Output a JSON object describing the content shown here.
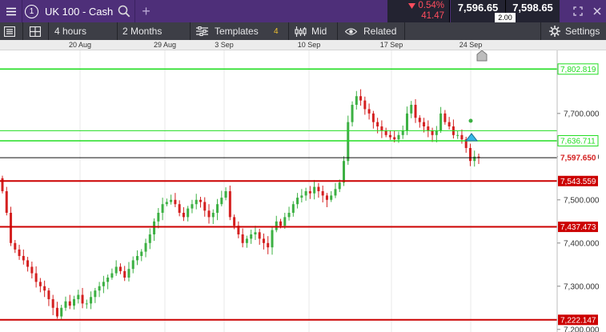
{
  "header": {
    "instrument_index": "1",
    "instrument_name": "UK 100 - Cash",
    "add_symbol": "+",
    "change_percent": "0.54%",
    "change_points": "41.47",
    "sell_price": "7,596.65",
    "buy_price": "7,598.65",
    "spread": "2.00",
    "colors": {
      "bar": "#4e2f79",
      "change": "#ff4d5e",
      "price_box": "#232331"
    }
  },
  "toolbar": {
    "interval": "4 hours",
    "range": "2 Months",
    "templates_label": "Templates",
    "templates_count": "4",
    "price_type": "Mid",
    "related_label": "Related",
    "settings_label": "Settings"
  },
  "chart_data": {
    "type": "candlestick",
    "x_ticks": [
      "20 Aug",
      "29 Aug",
      "3 Sep",
      "10 Sep",
      "17 Sep",
      "24 Sep"
    ],
    "y_ticks": [
      "7,700.000",
      "7,600.000",
      "7,500.000",
      "7,400.000",
      "7,300.000",
      "7,200.000"
    ],
    "ylim": [
      7194,
      7846
    ],
    "level_lines": [
      {
        "value": 7802.819,
        "label": "7,802.819",
        "color": "#22dd22",
        "style": "green"
      },
      {
        "value": 7660,
        "label": "",
        "color": "#22dd22",
        "style": "green-thin"
      },
      {
        "value": 7636.711,
        "label": "7,636.711",
        "color": "#22dd22",
        "style": "green"
      },
      {
        "value": 7597.65,
        "label": "7,597.650",
        "color": "#111111",
        "style": "current"
      },
      {
        "value": 7543.559,
        "label": "7,543.559",
        "color": "#cc0000",
        "style": "red"
      },
      {
        "value": 7437.473,
        "label": "7,437.473",
        "color": "#cc0000",
        "style": "red"
      },
      {
        "value": 7222.147,
        "label": "7,222.147",
        "color": "#cc0000",
        "style": "red"
      }
    ],
    "up_color": "#3cb043",
    "down_color": "#d42020",
    "closes": [
      7520,
      7470,
      7400,
      7385,
      7370,
      7360,
      7345,
      7330,
      7310,
      7300,
      7290,
      7270,
      7250,
      7230,
      7250,
      7265,
      7255,
      7270,
      7280,
      7260,
      7260,
      7275,
      7290,
      7300,
      7310,
      7320,
      7330,
      7345,
      7335,
      7320,
      7340,
      7360,
      7370,
      7380,
      7400,
      7420,
      7450,
      7470,
      7490,
      7495,
      7500,
      7490,
      7470,
      7460,
      7480,
      7490,
      7500,
      7495,
      7475,
      7460,
      7470,
      7490,
      7505,
      7520,
      7460,
      7440,
      7420,
      7400,
      7410,
      7420,
      7425,
      7410,
      7400,
      7390,
      7430,
      7450,
      7440,
      7460,
      7470,
      7490,
      7505,
      7510,
      7520,
      7515,
      7530,
      7520,
      7510,
      7500,
      7510,
      7525,
      7540,
      7590,
      7680,
      7720,
      7740,
      7730,
      7710,
      7700,
      7680,
      7670,
      7660,
      7650,
      7645,
      7640,
      7650,
      7660,
      7700,
      7720,
      7690,
      7680,
      7670,
      7660,
      7650,
      7660,
      7700,
      7680,
      7670,
      7650,
      7650,
      7640,
      7620,
      7590,
      7600,
      7597
    ]
  }
}
